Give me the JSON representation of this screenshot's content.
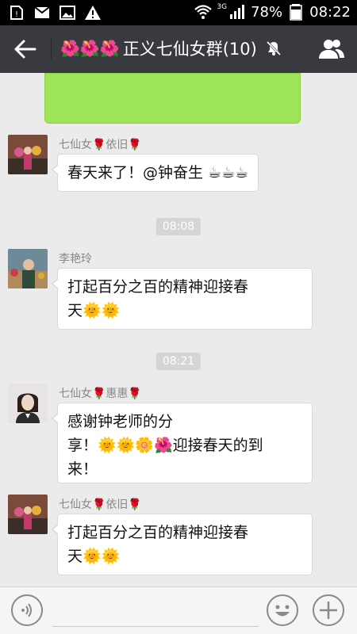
{
  "status_bar": {
    "network": "3G",
    "battery": "78%",
    "time": "08:22"
  },
  "header": {
    "flowers": "🌺🌺🌺",
    "title": "正义七仙女群(10)",
    "icons": [
      "back-arrow-icon",
      "mute-icon",
      "group-members-icon"
    ]
  },
  "messages": [
    {
      "sender": "七仙女🌹依旧🌹",
      "text": "春天来了！@钟奋生 ☕☕☕"
    },
    {
      "time": "08:08"
    },
    {
      "sender": "李艳玲",
      "line1": "打起百分之百的精神迎接春",
      "line2": "天🌞🌞"
    },
    {
      "time": "08:21"
    },
    {
      "sender": "七仙女🌹惠惠🌹",
      "line1": "感谢钟老师的分",
      "line2": "享！🌞🌞🌼🌺迎接春天的到",
      "line3": "来！"
    },
    {
      "sender": "七仙女🌹依旧🌹",
      "line1": "打起百分之百的精神迎接春",
      "line2": "天🌞🌞"
    }
  ],
  "input_bar": {
    "icons": [
      "voice-icon",
      "emoji-icon",
      "plus-icon"
    ]
  },
  "colors": {
    "status_bar": "#000000",
    "title_bar": "#393a3f",
    "chat_bg": "#ebebeb",
    "green_bubble": "#9ee457",
    "time_badge": "#d5d5d5"
  }
}
